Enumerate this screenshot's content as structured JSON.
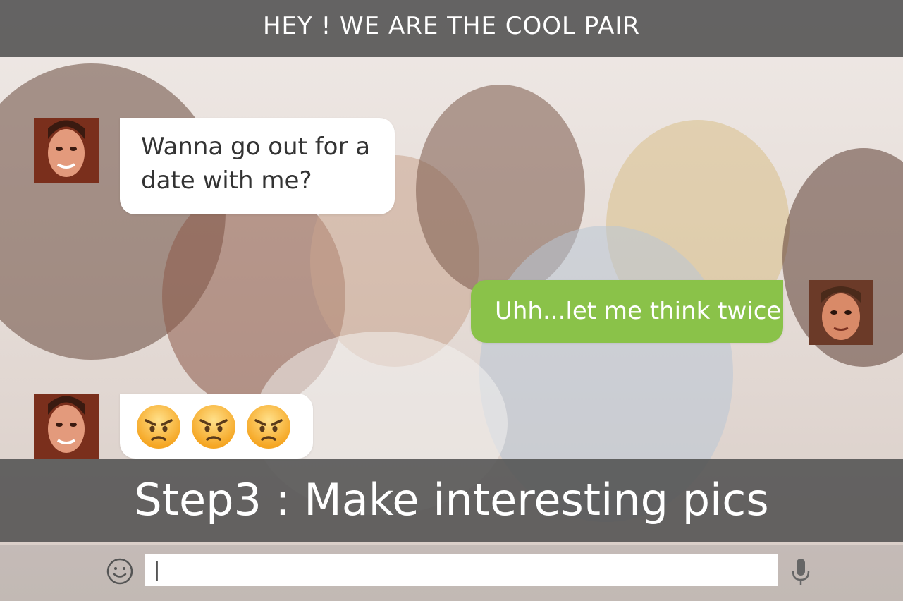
{
  "header": {
    "title": "HEY ! WE ARE THE COOL PAIR"
  },
  "messages": [
    {
      "from": "her",
      "text": "Wanna go out for a date with me?"
    },
    {
      "from": "him",
      "text": "Uhh...let me think twice"
    },
    {
      "from": "her",
      "emojis": [
        "angry-face",
        "angry-face",
        "angry-face"
      ]
    }
  ],
  "banner": {
    "text": "Step3 : Make interesting pics"
  },
  "composer": {
    "value": "|"
  },
  "colors": {
    "outgoing_bubble": "#8ac249",
    "header_bar": "#464646"
  }
}
